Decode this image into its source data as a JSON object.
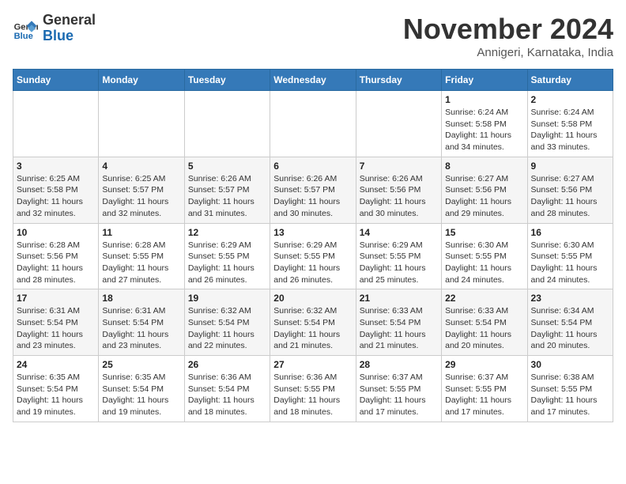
{
  "logo": {
    "line1": "General",
    "line2": "Blue"
  },
  "title": "November 2024",
  "subtitle": "Annigeri, Karnataka, India",
  "days_of_week": [
    "Sunday",
    "Monday",
    "Tuesday",
    "Wednesday",
    "Thursday",
    "Friday",
    "Saturday"
  ],
  "weeks": [
    [
      {
        "day": "",
        "info": ""
      },
      {
        "day": "",
        "info": ""
      },
      {
        "day": "",
        "info": ""
      },
      {
        "day": "",
        "info": ""
      },
      {
        "day": "",
        "info": ""
      },
      {
        "day": "1",
        "info": "Sunrise: 6:24 AM\nSunset: 5:58 PM\nDaylight: 11 hours\nand 34 minutes."
      },
      {
        "day": "2",
        "info": "Sunrise: 6:24 AM\nSunset: 5:58 PM\nDaylight: 11 hours\nand 33 minutes."
      }
    ],
    [
      {
        "day": "3",
        "info": "Sunrise: 6:25 AM\nSunset: 5:58 PM\nDaylight: 11 hours\nand 32 minutes."
      },
      {
        "day": "4",
        "info": "Sunrise: 6:25 AM\nSunset: 5:57 PM\nDaylight: 11 hours\nand 32 minutes."
      },
      {
        "day": "5",
        "info": "Sunrise: 6:26 AM\nSunset: 5:57 PM\nDaylight: 11 hours\nand 31 minutes."
      },
      {
        "day": "6",
        "info": "Sunrise: 6:26 AM\nSunset: 5:57 PM\nDaylight: 11 hours\nand 30 minutes."
      },
      {
        "day": "7",
        "info": "Sunrise: 6:26 AM\nSunset: 5:56 PM\nDaylight: 11 hours\nand 30 minutes."
      },
      {
        "day": "8",
        "info": "Sunrise: 6:27 AM\nSunset: 5:56 PM\nDaylight: 11 hours\nand 29 minutes."
      },
      {
        "day": "9",
        "info": "Sunrise: 6:27 AM\nSunset: 5:56 PM\nDaylight: 11 hours\nand 28 minutes."
      }
    ],
    [
      {
        "day": "10",
        "info": "Sunrise: 6:28 AM\nSunset: 5:56 PM\nDaylight: 11 hours\nand 28 minutes."
      },
      {
        "day": "11",
        "info": "Sunrise: 6:28 AM\nSunset: 5:55 PM\nDaylight: 11 hours\nand 27 minutes."
      },
      {
        "day": "12",
        "info": "Sunrise: 6:29 AM\nSunset: 5:55 PM\nDaylight: 11 hours\nand 26 minutes."
      },
      {
        "day": "13",
        "info": "Sunrise: 6:29 AM\nSunset: 5:55 PM\nDaylight: 11 hours\nand 26 minutes."
      },
      {
        "day": "14",
        "info": "Sunrise: 6:29 AM\nSunset: 5:55 PM\nDaylight: 11 hours\nand 25 minutes."
      },
      {
        "day": "15",
        "info": "Sunrise: 6:30 AM\nSunset: 5:55 PM\nDaylight: 11 hours\nand 24 minutes."
      },
      {
        "day": "16",
        "info": "Sunrise: 6:30 AM\nSunset: 5:55 PM\nDaylight: 11 hours\nand 24 minutes."
      }
    ],
    [
      {
        "day": "17",
        "info": "Sunrise: 6:31 AM\nSunset: 5:54 PM\nDaylight: 11 hours\nand 23 minutes."
      },
      {
        "day": "18",
        "info": "Sunrise: 6:31 AM\nSunset: 5:54 PM\nDaylight: 11 hours\nand 23 minutes."
      },
      {
        "day": "19",
        "info": "Sunrise: 6:32 AM\nSunset: 5:54 PM\nDaylight: 11 hours\nand 22 minutes."
      },
      {
        "day": "20",
        "info": "Sunrise: 6:32 AM\nSunset: 5:54 PM\nDaylight: 11 hours\nand 21 minutes."
      },
      {
        "day": "21",
        "info": "Sunrise: 6:33 AM\nSunset: 5:54 PM\nDaylight: 11 hours\nand 21 minutes."
      },
      {
        "day": "22",
        "info": "Sunrise: 6:33 AM\nSunset: 5:54 PM\nDaylight: 11 hours\nand 20 minutes."
      },
      {
        "day": "23",
        "info": "Sunrise: 6:34 AM\nSunset: 5:54 PM\nDaylight: 11 hours\nand 20 minutes."
      }
    ],
    [
      {
        "day": "24",
        "info": "Sunrise: 6:35 AM\nSunset: 5:54 PM\nDaylight: 11 hours\nand 19 minutes."
      },
      {
        "day": "25",
        "info": "Sunrise: 6:35 AM\nSunset: 5:54 PM\nDaylight: 11 hours\nand 19 minutes."
      },
      {
        "day": "26",
        "info": "Sunrise: 6:36 AM\nSunset: 5:54 PM\nDaylight: 11 hours\nand 18 minutes."
      },
      {
        "day": "27",
        "info": "Sunrise: 6:36 AM\nSunset: 5:55 PM\nDaylight: 11 hours\nand 18 minutes."
      },
      {
        "day": "28",
        "info": "Sunrise: 6:37 AM\nSunset: 5:55 PM\nDaylight: 11 hours\nand 17 minutes."
      },
      {
        "day": "29",
        "info": "Sunrise: 6:37 AM\nSunset: 5:55 PM\nDaylight: 11 hours\nand 17 minutes."
      },
      {
        "day": "30",
        "info": "Sunrise: 6:38 AM\nSunset: 5:55 PM\nDaylight: 11 hours\nand 17 minutes."
      }
    ]
  ]
}
